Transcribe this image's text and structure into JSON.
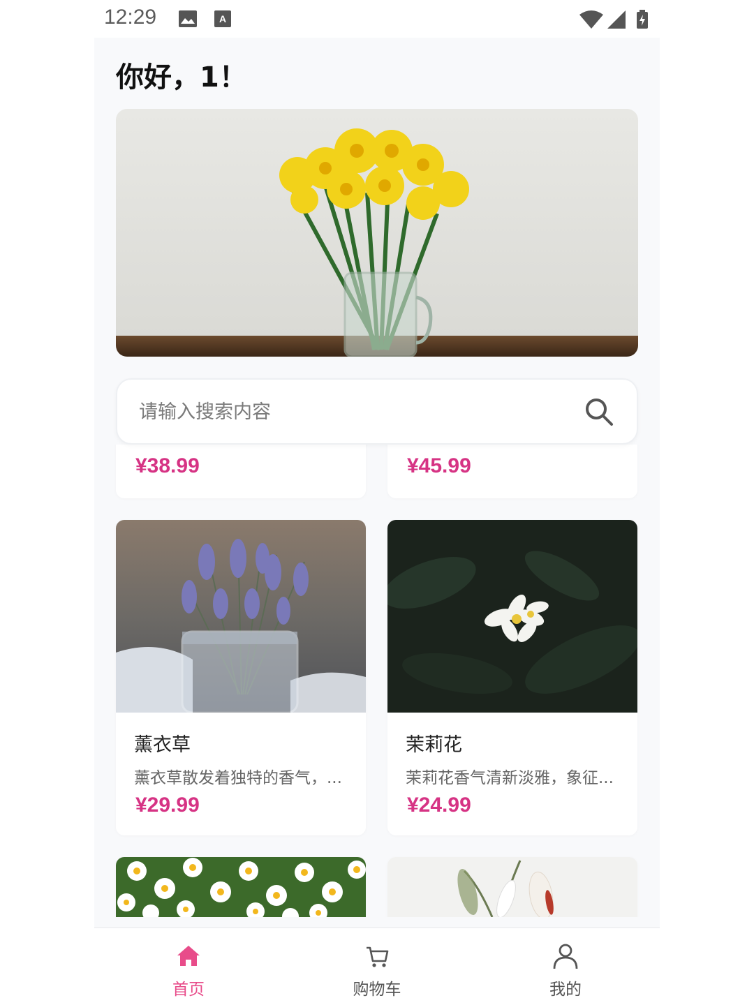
{
  "status_bar": {
    "time": "12:29"
  },
  "greeting": "你好，1！",
  "search": {
    "placeholder": "请输入搜索内容"
  },
  "prices_top": [
    "¥38.99",
    "¥45.99"
  ],
  "products": [
    {
      "name": "薰衣草",
      "desc": "薰衣草散发着独特的香气，...",
      "price": "¥29.99"
    },
    {
      "name": "茉莉花",
      "desc": "茉莉花香气清新淡雅，象征...",
      "price": "¥24.99"
    }
  ],
  "tabs": [
    {
      "label": "首页",
      "icon": "home-icon",
      "active": true
    },
    {
      "label": "购物车",
      "icon": "cart-icon",
      "active": false
    },
    {
      "label": "我的",
      "icon": "user-icon",
      "active": false
    }
  ],
  "colors": {
    "accent": "#d63384",
    "tab_active": "#e84c8a",
    "tab_inactive": "#666666"
  }
}
